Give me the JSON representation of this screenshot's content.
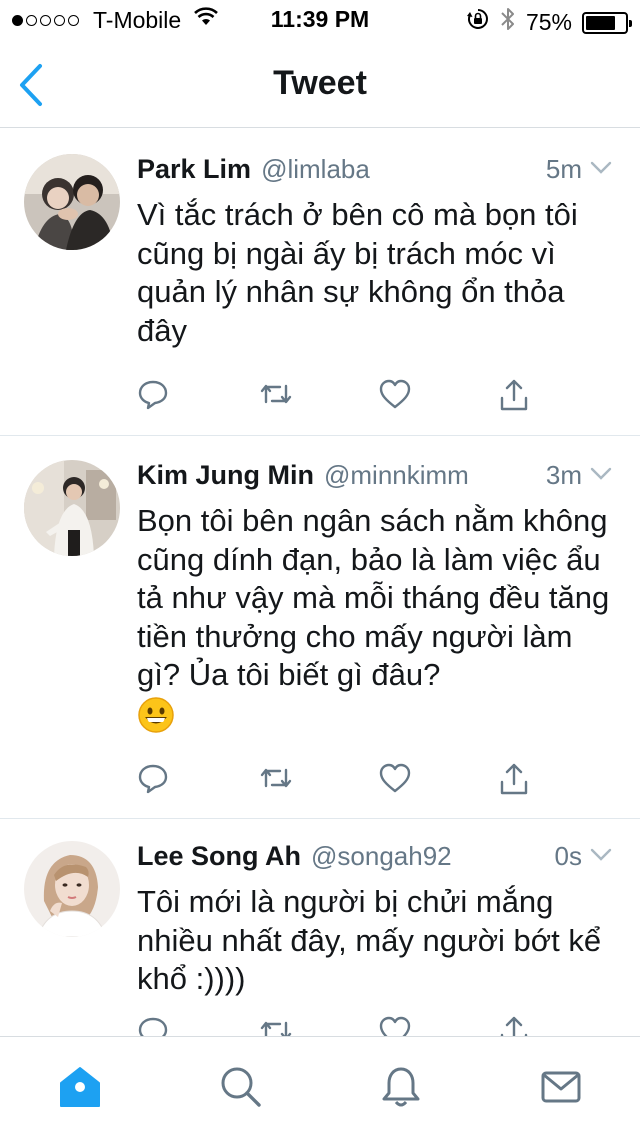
{
  "status_bar": {
    "signal_dots_filled": 1,
    "signal_dots_total": 5,
    "carrier": "T-Mobile",
    "time": "11:39 PM",
    "battery_percent": "75%",
    "battery_level": 0.75
  },
  "nav": {
    "title": "Tweet",
    "back_icon": "chevron-left-icon",
    "accent_color": "#1da1f2"
  },
  "tweets": [
    {
      "name": "Park Lim",
      "handle": "@limlaba",
      "time": "5m",
      "text": "Vì tắc trách ở bên cô mà bọn tôi cũng bị ngài ấy bị trách móc vì quản lý nhân sự không ổn thỏa đây"
    },
    {
      "name": "Kim Jung Min",
      "handle": "@minnkimm",
      "time": "3m",
      "text": "Bọn tôi bên ngân sách nằm không cũng dính đạn, bảo là làm việc ẩu tả như vậy mà mỗi tháng đều tăng tiền thưởng cho mấy người làm gì? Ủa tôi biết gì đâu?"
    },
    {
      "name": "Lee Song Ah",
      "handle": "@songah92",
      "time": "0s",
      "text": "Tôi mới là người bị chửi mắng nhiều nhất đây, mấy người bớt kể khổ :))))"
    }
  ],
  "tab_bar": {
    "tabs": [
      "home-icon",
      "search-icon",
      "notifications-icon",
      "messages-icon"
    ],
    "active_tab": "home-icon"
  }
}
